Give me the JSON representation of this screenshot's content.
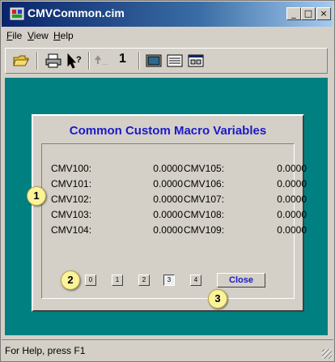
{
  "window": {
    "title": "CMVCommon.cim",
    "controls": {
      "minimize": "_",
      "maximize": "□",
      "close": "×"
    }
  },
  "menubar": {
    "items": [
      {
        "label": "File",
        "accel": "F",
        "rest": "ile"
      },
      {
        "label": "View",
        "accel": "V",
        "rest": "iew"
      },
      {
        "label": "Help",
        "accel": "H",
        "rest": "elp"
      }
    ]
  },
  "toolbar": {
    "page_number": "1"
  },
  "dialog": {
    "title": "Common Custom Macro Variables",
    "left_column": [
      {
        "name": "CMV100:",
        "value": "0.0000"
      },
      {
        "name": "CMV101:",
        "value": "0.0000"
      },
      {
        "name": "CMV102:",
        "value": "0.0000"
      },
      {
        "name": "CMV103:",
        "value": "0.0000"
      },
      {
        "name": "CMV104:",
        "value": "0.0000"
      }
    ],
    "right_column": [
      {
        "name": "CMV105:",
        "value": "0.0000"
      },
      {
        "name": "CMV106:",
        "value": "0.0000"
      },
      {
        "name": "CMV107:",
        "value": "0.0000"
      },
      {
        "name": "CMV108:",
        "value": "0.0000"
      },
      {
        "name": "CMV109:",
        "value": "0.0000"
      }
    ],
    "page_buttons": [
      "0",
      "1",
      "2",
      "3",
      "4"
    ],
    "active_page": "3",
    "close_label": "Close"
  },
  "callouts": [
    "1",
    "2",
    "3"
  ],
  "status": {
    "text": "For Help, press F1"
  }
}
